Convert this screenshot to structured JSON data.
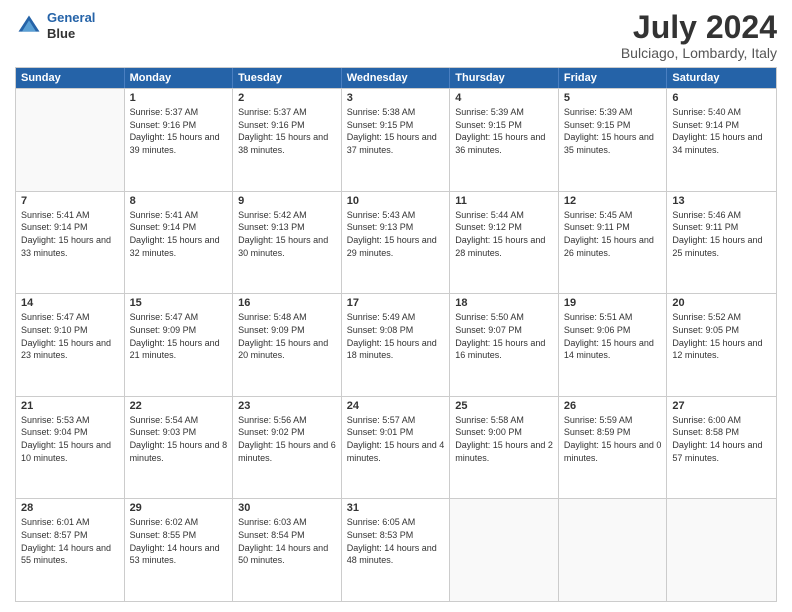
{
  "header": {
    "logo_line1": "General",
    "logo_line2": "Blue",
    "month_year": "July 2024",
    "location": "Bulciago, Lombardy, Italy"
  },
  "days_of_week": [
    "Sunday",
    "Monday",
    "Tuesday",
    "Wednesday",
    "Thursday",
    "Friday",
    "Saturday"
  ],
  "weeks": [
    [
      {
        "date": "",
        "empty": true
      },
      {
        "date": "1",
        "sunrise": "5:37 AM",
        "sunset": "9:16 PM",
        "daylight": "15 hours and 39 minutes."
      },
      {
        "date": "2",
        "sunrise": "5:37 AM",
        "sunset": "9:16 PM",
        "daylight": "15 hours and 38 minutes."
      },
      {
        "date": "3",
        "sunrise": "5:38 AM",
        "sunset": "9:15 PM",
        "daylight": "15 hours and 37 minutes."
      },
      {
        "date": "4",
        "sunrise": "5:39 AM",
        "sunset": "9:15 PM",
        "daylight": "15 hours and 36 minutes."
      },
      {
        "date": "5",
        "sunrise": "5:39 AM",
        "sunset": "9:15 PM",
        "daylight": "15 hours and 35 minutes."
      },
      {
        "date": "6",
        "sunrise": "5:40 AM",
        "sunset": "9:14 PM",
        "daylight": "15 hours and 34 minutes."
      }
    ],
    [
      {
        "date": "7",
        "sunrise": "5:41 AM",
        "sunset": "9:14 PM",
        "daylight": "15 hours and 33 minutes."
      },
      {
        "date": "8",
        "sunrise": "5:41 AM",
        "sunset": "9:14 PM",
        "daylight": "15 hours and 32 minutes."
      },
      {
        "date": "9",
        "sunrise": "5:42 AM",
        "sunset": "9:13 PM",
        "daylight": "15 hours and 30 minutes."
      },
      {
        "date": "10",
        "sunrise": "5:43 AM",
        "sunset": "9:13 PM",
        "daylight": "15 hours and 29 minutes."
      },
      {
        "date": "11",
        "sunrise": "5:44 AM",
        "sunset": "9:12 PM",
        "daylight": "15 hours and 28 minutes."
      },
      {
        "date": "12",
        "sunrise": "5:45 AM",
        "sunset": "9:11 PM",
        "daylight": "15 hours and 26 minutes."
      },
      {
        "date": "13",
        "sunrise": "5:46 AM",
        "sunset": "9:11 PM",
        "daylight": "15 hours and 25 minutes."
      }
    ],
    [
      {
        "date": "14",
        "sunrise": "5:47 AM",
        "sunset": "9:10 PM",
        "daylight": "15 hours and 23 minutes."
      },
      {
        "date": "15",
        "sunrise": "5:47 AM",
        "sunset": "9:09 PM",
        "daylight": "15 hours and 21 minutes."
      },
      {
        "date": "16",
        "sunrise": "5:48 AM",
        "sunset": "9:09 PM",
        "daylight": "15 hours and 20 minutes."
      },
      {
        "date": "17",
        "sunrise": "5:49 AM",
        "sunset": "9:08 PM",
        "daylight": "15 hours and 18 minutes."
      },
      {
        "date": "18",
        "sunrise": "5:50 AM",
        "sunset": "9:07 PM",
        "daylight": "15 hours and 16 minutes."
      },
      {
        "date": "19",
        "sunrise": "5:51 AM",
        "sunset": "9:06 PM",
        "daylight": "15 hours and 14 minutes."
      },
      {
        "date": "20",
        "sunrise": "5:52 AM",
        "sunset": "9:05 PM",
        "daylight": "15 hours and 12 minutes."
      }
    ],
    [
      {
        "date": "21",
        "sunrise": "5:53 AM",
        "sunset": "9:04 PM",
        "daylight": "15 hours and 10 minutes."
      },
      {
        "date": "22",
        "sunrise": "5:54 AM",
        "sunset": "9:03 PM",
        "daylight": "15 hours and 8 minutes."
      },
      {
        "date": "23",
        "sunrise": "5:56 AM",
        "sunset": "9:02 PM",
        "daylight": "15 hours and 6 minutes."
      },
      {
        "date": "24",
        "sunrise": "5:57 AM",
        "sunset": "9:01 PM",
        "daylight": "15 hours and 4 minutes."
      },
      {
        "date": "25",
        "sunrise": "5:58 AM",
        "sunset": "9:00 PM",
        "daylight": "15 hours and 2 minutes."
      },
      {
        "date": "26",
        "sunrise": "5:59 AM",
        "sunset": "8:59 PM",
        "daylight": "15 hours and 0 minutes."
      },
      {
        "date": "27",
        "sunrise": "6:00 AM",
        "sunset": "8:58 PM",
        "daylight": "14 hours and 57 minutes."
      }
    ],
    [
      {
        "date": "28",
        "sunrise": "6:01 AM",
        "sunset": "8:57 PM",
        "daylight": "14 hours and 55 minutes."
      },
      {
        "date": "29",
        "sunrise": "6:02 AM",
        "sunset": "8:55 PM",
        "daylight": "14 hours and 53 minutes."
      },
      {
        "date": "30",
        "sunrise": "6:03 AM",
        "sunset": "8:54 PM",
        "daylight": "14 hours and 50 minutes."
      },
      {
        "date": "31",
        "sunrise": "6:05 AM",
        "sunset": "8:53 PM",
        "daylight": "14 hours and 48 minutes."
      },
      {
        "date": "",
        "empty": true
      },
      {
        "date": "",
        "empty": true
      },
      {
        "date": "",
        "empty": true
      }
    ]
  ]
}
